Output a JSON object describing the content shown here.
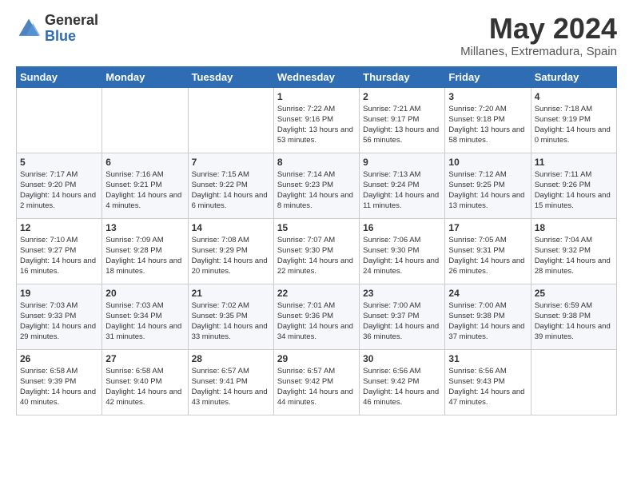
{
  "header": {
    "logo_general": "General",
    "logo_blue": "Blue",
    "title": "May 2024",
    "subtitle": "Millanes, Extremadura, Spain"
  },
  "columns": [
    "Sunday",
    "Monday",
    "Tuesday",
    "Wednesday",
    "Thursday",
    "Friday",
    "Saturday"
  ],
  "weeks": [
    [
      {
        "num": "",
        "info": ""
      },
      {
        "num": "",
        "info": ""
      },
      {
        "num": "",
        "info": ""
      },
      {
        "num": "1",
        "info": "Sunrise: 7:22 AM\nSunset: 9:16 PM\nDaylight: 13 hours\nand 53 minutes."
      },
      {
        "num": "2",
        "info": "Sunrise: 7:21 AM\nSunset: 9:17 PM\nDaylight: 13 hours\nand 56 minutes."
      },
      {
        "num": "3",
        "info": "Sunrise: 7:20 AM\nSunset: 9:18 PM\nDaylight: 13 hours\nand 58 minutes."
      },
      {
        "num": "4",
        "info": "Sunrise: 7:18 AM\nSunset: 9:19 PM\nDaylight: 14 hours\nand 0 minutes."
      }
    ],
    [
      {
        "num": "5",
        "info": "Sunrise: 7:17 AM\nSunset: 9:20 PM\nDaylight: 14 hours\nand 2 minutes."
      },
      {
        "num": "6",
        "info": "Sunrise: 7:16 AM\nSunset: 9:21 PM\nDaylight: 14 hours\nand 4 minutes."
      },
      {
        "num": "7",
        "info": "Sunrise: 7:15 AM\nSunset: 9:22 PM\nDaylight: 14 hours\nand 6 minutes."
      },
      {
        "num": "8",
        "info": "Sunrise: 7:14 AM\nSunset: 9:23 PM\nDaylight: 14 hours\nand 8 minutes."
      },
      {
        "num": "9",
        "info": "Sunrise: 7:13 AM\nSunset: 9:24 PM\nDaylight: 14 hours\nand 11 minutes."
      },
      {
        "num": "10",
        "info": "Sunrise: 7:12 AM\nSunset: 9:25 PM\nDaylight: 14 hours\nand 13 minutes."
      },
      {
        "num": "11",
        "info": "Sunrise: 7:11 AM\nSunset: 9:26 PM\nDaylight: 14 hours\nand 15 minutes."
      }
    ],
    [
      {
        "num": "12",
        "info": "Sunrise: 7:10 AM\nSunset: 9:27 PM\nDaylight: 14 hours\nand 16 minutes."
      },
      {
        "num": "13",
        "info": "Sunrise: 7:09 AM\nSunset: 9:28 PM\nDaylight: 14 hours\nand 18 minutes."
      },
      {
        "num": "14",
        "info": "Sunrise: 7:08 AM\nSunset: 9:29 PM\nDaylight: 14 hours\nand 20 minutes."
      },
      {
        "num": "15",
        "info": "Sunrise: 7:07 AM\nSunset: 9:30 PM\nDaylight: 14 hours\nand 22 minutes."
      },
      {
        "num": "16",
        "info": "Sunrise: 7:06 AM\nSunset: 9:30 PM\nDaylight: 14 hours\nand 24 minutes."
      },
      {
        "num": "17",
        "info": "Sunrise: 7:05 AM\nSunset: 9:31 PM\nDaylight: 14 hours\nand 26 minutes."
      },
      {
        "num": "18",
        "info": "Sunrise: 7:04 AM\nSunset: 9:32 PM\nDaylight: 14 hours\nand 28 minutes."
      }
    ],
    [
      {
        "num": "19",
        "info": "Sunrise: 7:03 AM\nSunset: 9:33 PM\nDaylight: 14 hours\nand 29 minutes."
      },
      {
        "num": "20",
        "info": "Sunrise: 7:03 AM\nSunset: 9:34 PM\nDaylight: 14 hours\nand 31 minutes."
      },
      {
        "num": "21",
        "info": "Sunrise: 7:02 AM\nSunset: 9:35 PM\nDaylight: 14 hours\nand 33 minutes."
      },
      {
        "num": "22",
        "info": "Sunrise: 7:01 AM\nSunset: 9:36 PM\nDaylight: 14 hours\nand 34 minutes."
      },
      {
        "num": "23",
        "info": "Sunrise: 7:00 AM\nSunset: 9:37 PM\nDaylight: 14 hours\nand 36 minutes."
      },
      {
        "num": "24",
        "info": "Sunrise: 7:00 AM\nSunset: 9:38 PM\nDaylight: 14 hours\nand 37 minutes."
      },
      {
        "num": "25",
        "info": "Sunrise: 6:59 AM\nSunset: 9:38 PM\nDaylight: 14 hours\nand 39 minutes."
      }
    ],
    [
      {
        "num": "26",
        "info": "Sunrise: 6:58 AM\nSunset: 9:39 PM\nDaylight: 14 hours\nand 40 minutes."
      },
      {
        "num": "27",
        "info": "Sunrise: 6:58 AM\nSunset: 9:40 PM\nDaylight: 14 hours\nand 42 minutes."
      },
      {
        "num": "28",
        "info": "Sunrise: 6:57 AM\nSunset: 9:41 PM\nDaylight: 14 hours\nand 43 minutes."
      },
      {
        "num": "29",
        "info": "Sunrise: 6:57 AM\nSunset: 9:42 PM\nDaylight: 14 hours\nand 44 minutes."
      },
      {
        "num": "30",
        "info": "Sunrise: 6:56 AM\nSunset: 9:42 PM\nDaylight: 14 hours\nand 46 minutes."
      },
      {
        "num": "31",
        "info": "Sunrise: 6:56 AM\nSunset: 9:43 PM\nDaylight: 14 hours\nand 47 minutes."
      },
      {
        "num": "",
        "info": ""
      }
    ]
  ]
}
